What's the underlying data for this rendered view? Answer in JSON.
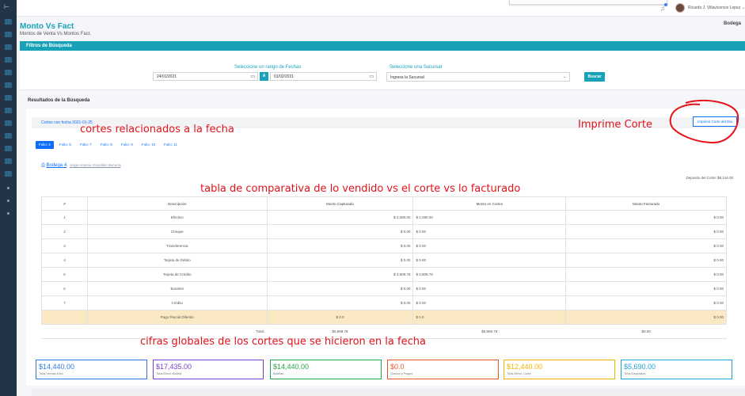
{
  "app": {
    "title": "Monto Vs Fact",
    "subtitle": "Montos de Venta Vs Montos Fact.",
    "right_label": "Bodega",
    "user_name": "Ricardo J. Villavicencio Lopez"
  },
  "filters": {
    "header": "Filtros de Búsqueda",
    "date_range_label": "Seleccione un rango de Fechas",
    "date_from": "24/01/2021",
    "date_sep": "A",
    "date_to": "01/02/2021",
    "branch_label": "Seleccione una Sucursal",
    "branch_value": "Ingresa la Sucursal",
    "search_button": "Buscar"
  },
  "results": {
    "title": "Resultados de la Búsqueda",
    "cortes_label": "Cortes con fecha 2021-01-25",
    "print_button": "Imprimir Corte del Dia",
    "tabs": [
      "Folio: 4",
      "Folio: 5",
      "Folio: 7",
      "Folio: 8",
      "Folio: 9",
      "Folio: 10",
      "Folio: 11"
    ],
    "active_tab": 0,
    "bodega_name": "Bodega 4",
    "bodega_person": "Jorge Antonio González Becerra",
    "deposito": "Deposito del Corte: $6,116.00"
  },
  "table": {
    "headers": [
      "#",
      "Descripción",
      "Monto Capturado",
      "Monto en Cortes",
      "Monto Facturado"
    ],
    "rows": [
      {
        "n": "1",
        "desc": "Efectivo",
        "cap": "$ 2,090.00",
        "cortes": "$ 2,090.00",
        "fact": "$ 0.00"
      },
      {
        "n": "2",
        "desc": "Cheque",
        "cap": "$ 0.00",
        "cortes": "$ 0.00",
        "fact": "$ 0.00"
      },
      {
        "n": "3",
        "desc": "Transferencia",
        "cap": "$ 0.00",
        "cortes": "$ 0.00",
        "fact": "$ 0.00"
      },
      {
        "n": "4",
        "desc": "Tarjeta de Débito",
        "cap": "$ 0.00",
        "cortes": "$ 0.00",
        "fact": "$ 0.00"
      },
      {
        "n": "5",
        "desc": "Tarjeta de Crédito",
        "cap": "$ 3,909.78",
        "cortes": "$ 3,909.78",
        "fact": "$ 0.00"
      },
      {
        "n": "6",
        "desc": "Bonetes",
        "cap": "$ 0.00",
        "cortes": "$ 0.00",
        "fact": "$ 0.00"
      },
      {
        "n": "7",
        "desc": "Crédito",
        "cap": "$ 0.00",
        "cortes": "$ 0.00",
        "fact": "$ 0.00"
      },
      {
        "n": "",
        "desc": "Pago Parcial Diferido",
        "cap": "$ 0.0",
        "cortes": "$ 0.0",
        "fact": "$ 0.00"
      }
    ],
    "total_label": "Total:",
    "total_cap": "$5,999.78",
    "total_cortes": "$5,999.78",
    "total_fact": "$0.00"
  },
  "summary": [
    {
      "amount": "$14,440.00",
      "caption": "Total Ventas Efec.",
      "color": "#2d7be5"
    },
    {
      "amount": "$17,435.00",
      "caption": "Total Efect. Boleta",
      "color": "#7a3fd0"
    },
    {
      "amount": "$14,440.00",
      "caption": "Boletas",
      "color": "#28a745"
    },
    {
      "amount": "$0.0",
      "caption": "Gastos y Pagos",
      "color": "#e4572e"
    },
    {
      "amount": "$12,440.00",
      "caption": "Total Efect. Corte",
      "color": "#f0b400"
    },
    {
      "amount": "$5,690.00",
      "caption": "Total Depositos",
      "color": "#21a0d8"
    }
  ],
  "annotations": {
    "cortes": "cortes relacionados a la fecha",
    "imprime": "Imprime Corte",
    "tabla": "tabla de comparativa de lo vendido vs el corte vs lo facturado",
    "cifras": "cifras globales de los cortes que se hicieron en la fecha",
    "color": "#e3121b"
  }
}
